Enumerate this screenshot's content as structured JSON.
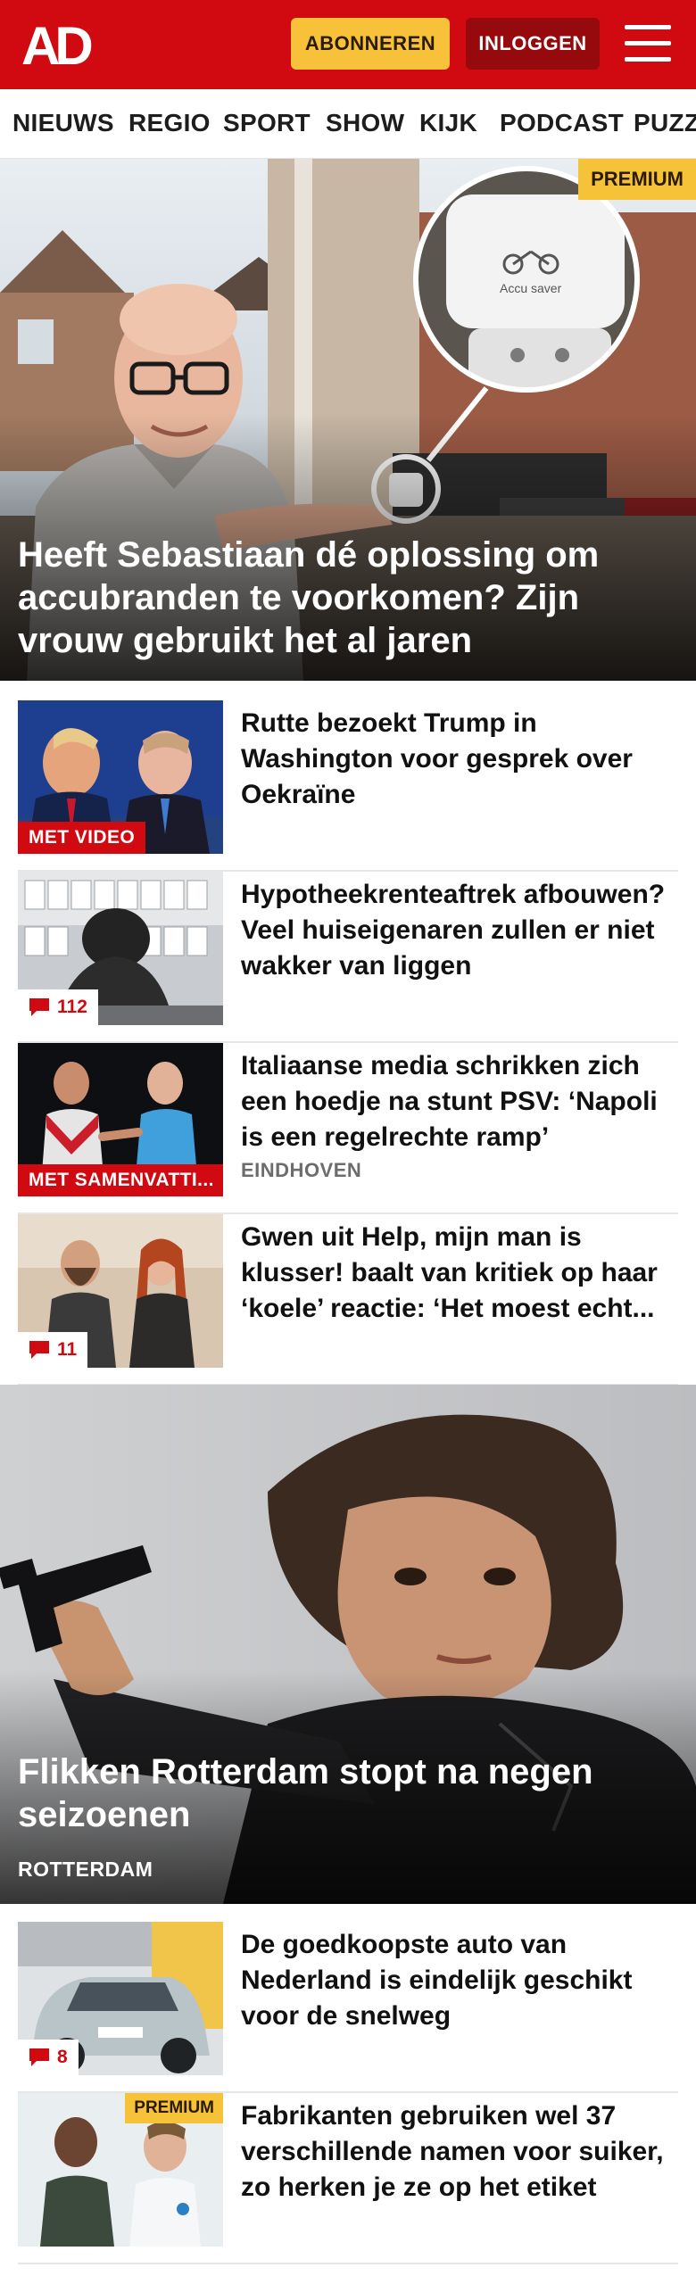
{
  "header": {
    "logo_text": "AD",
    "subscribe_label": "ABONNEREN",
    "login_label": "INLOGGEN"
  },
  "nav": {
    "items": [
      "NIEUWS",
      "REGIO",
      "SPORT",
      "SHOW",
      "KIJK",
      "PODCAST",
      "PUZZ"
    ]
  },
  "hero": {
    "badge": "PREMIUM",
    "product_text": "Accu saver",
    "title": "Heeft Sebastiaan dé oplossing om accubranden te voorkomen? Zijn vrouw gebruikt het al jaren"
  },
  "articles": [
    {
      "title": "Rutte bezoekt Trump in Washington voor gesprek over Oekraïne",
      "label": "MET VIDEO"
    },
    {
      "title": "Hypotheekrenteaftrek afbouwen? Veel huiseigenaren zullen er niet wakker van liggen",
      "comments": "112"
    },
    {
      "title": "Italiaanse media schrikken zich een hoedje na stunt PSV: ‘Napoli is een regelrechte ramp’",
      "label": "MET SAMENVATTI...",
      "location": "EINDHOVEN"
    },
    {
      "title": "Gwen uit Help, mijn man is klusser! baalt van kritiek op haar ‘koele’ reactie: ‘Het moest echt...",
      "comments": "11"
    }
  ],
  "feature": {
    "title": "Flikken Rotterdam stopt na negen seizoenen",
    "location": "ROTTERDAM"
  },
  "articles2": [
    {
      "title": "De goedkoopste auto van Nederland is eindelijk geschikt voor de snelweg",
      "comments": "8"
    },
    {
      "title": "Fabrikanten gebruiken wel 37 verschillende namen voor suiker, zo herken je ze op het etiket",
      "badge": "PREMIUM"
    }
  ],
  "colors": {
    "brand_red": "#d10a11",
    "dark_red": "#960a0d",
    "premium_yellow": "#f5c238"
  }
}
